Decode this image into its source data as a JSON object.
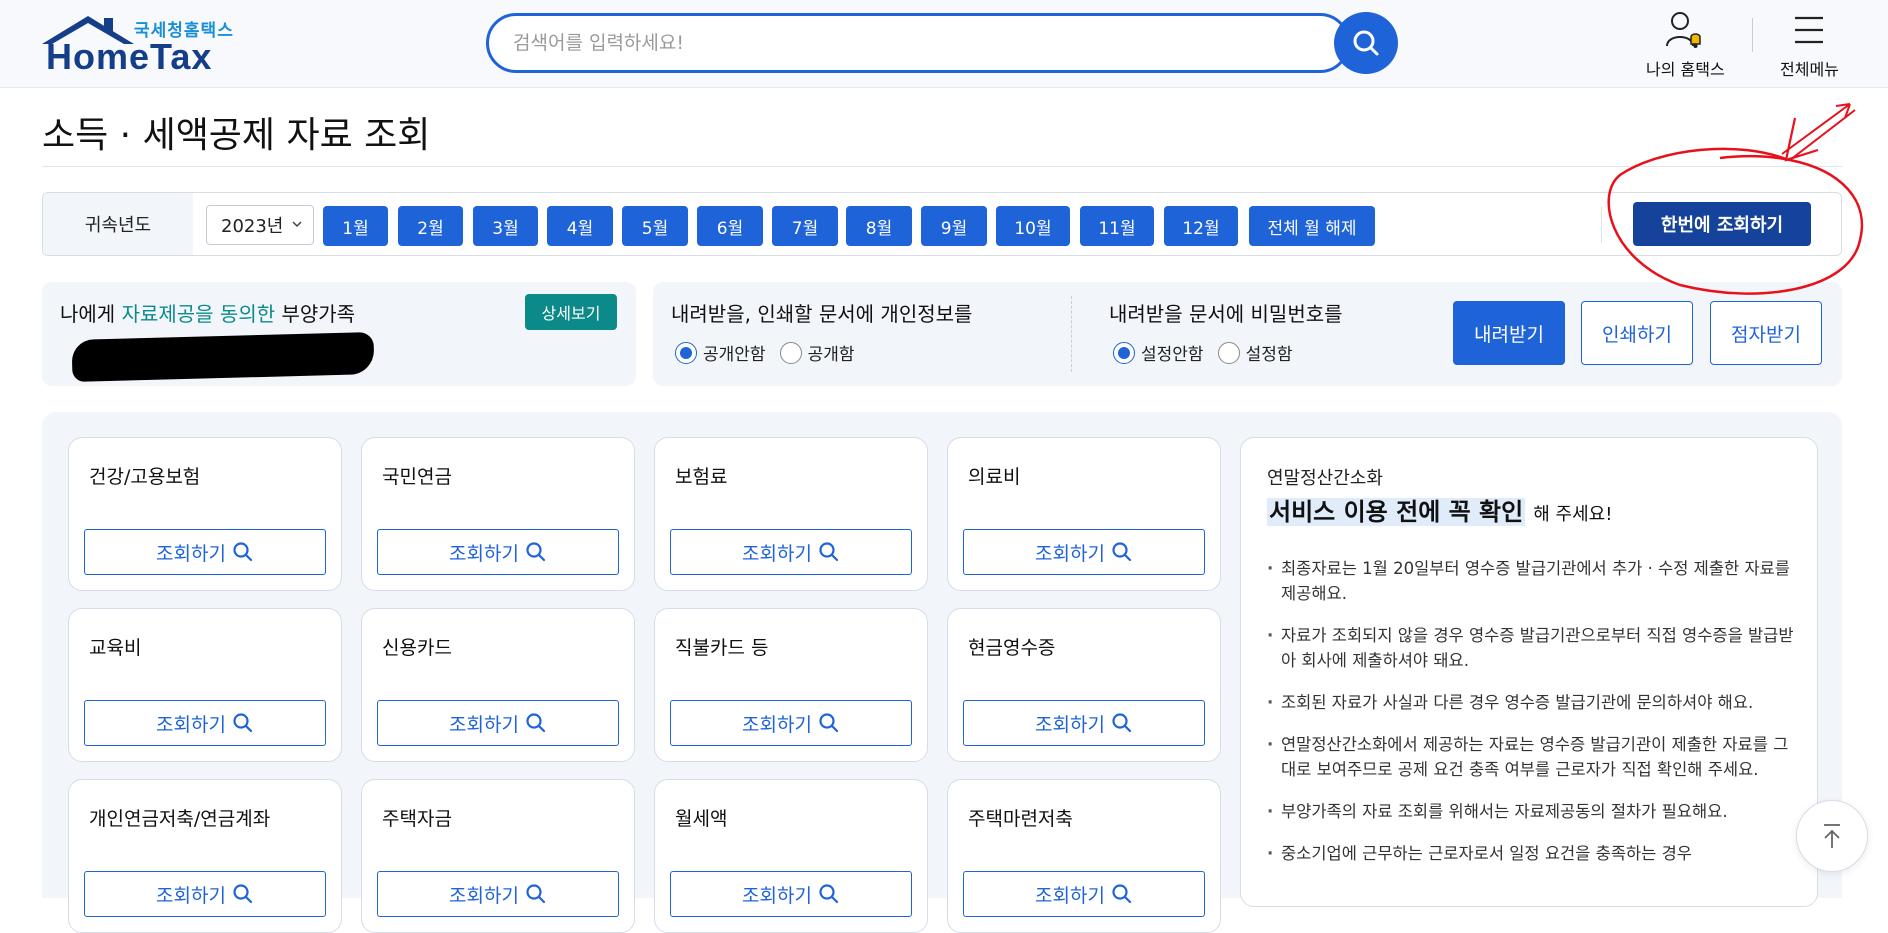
{
  "header": {
    "logo_sub": "국세청홈택스",
    "logo_main": "HomeTax",
    "search_placeholder": "검색어를 입력하세요!",
    "my_hometax": "나의 홈택스",
    "all_menu": "전체메뉴"
  },
  "page": {
    "title": "소득 · 세액공제 자료 조회"
  },
  "filter": {
    "label": "귀속년도",
    "year": "2023년",
    "months": [
      "1월",
      "2월",
      "3월",
      "4월",
      "5월",
      "6월",
      "7월",
      "8월",
      "9월",
      "10월",
      "11월",
      "12월"
    ],
    "clear_all": "전체 월 해제",
    "once_button": "한번에 조회하기"
  },
  "dependents": {
    "title_pre": "나에게 ",
    "title_hl": "자료제공을 동의한",
    "title_post": " 부양가족",
    "detail_button": "상세보기"
  },
  "options": {
    "privacy_title": "내려받을, 인쇄할 문서에 개인정보를",
    "privacy_options": [
      "공개안함",
      "공개함"
    ],
    "password_title": "내려받을 문서에 비밀번호를",
    "password_options": [
      "설정안함",
      "설정함"
    ],
    "download": "내려받기",
    "print": "인쇄하기",
    "braille": "점자받기"
  },
  "cards": [
    {
      "title": "건강/고용보험",
      "button": "조회하기"
    },
    {
      "title": "국민연금",
      "button": "조회하기"
    },
    {
      "title": "보험료",
      "button": "조회하기"
    },
    {
      "title": "의료비",
      "button": "조회하기"
    },
    {
      "title": "교육비",
      "button": "조회하기"
    },
    {
      "title": "신용카드",
      "button": "조회하기"
    },
    {
      "title": "직불카드 등",
      "button": "조회하기"
    },
    {
      "title": "현금영수증",
      "button": "조회하기"
    },
    {
      "title": "개인연금저축/연금계좌",
      "button": "조회하기"
    },
    {
      "title": "주택자금",
      "button": "조회하기"
    },
    {
      "title": "월세액",
      "button": "조회하기"
    },
    {
      "title": "주택마련저축",
      "button": "조회하기"
    }
  ],
  "notice": {
    "sub": "연말정산간소화",
    "head": "서비스 이용 전에 꼭 확인",
    "head_tail": "해 주세요!",
    "items": [
      "최종자료는 1월 20일부터 영수증 발급기관에서 추가 · 수정 제출한 자료를 제공해요.",
      "자료가 조회되지 않을 경우 영수증 발급기관으로부터 직접 영수증을 발급받아 회사에 제출하셔야 돼요.",
      "조회된 자료가 사실과 다른 경우 영수증 발급기관에 문의하셔야 해요.",
      "연말정산간소화에서 제공하는 자료는 영수증 발급기관이 제출한 자료를 그대로 보여주므로 공제 요건 충족 여부를 근로자가 직접 확인해 주세요.",
      "부양가족의 자료 조회를 위해서는 자료제공동의 절차가 필요해요.",
      "중소기업에 근무하는 근로자로서 일정 요건을 충족하는 경우"
    ]
  },
  "colors": {
    "primary": "#1f63d8",
    "dark_primary": "#15439b",
    "teal": "#0c8a8a",
    "annotation": "#e8101a"
  }
}
